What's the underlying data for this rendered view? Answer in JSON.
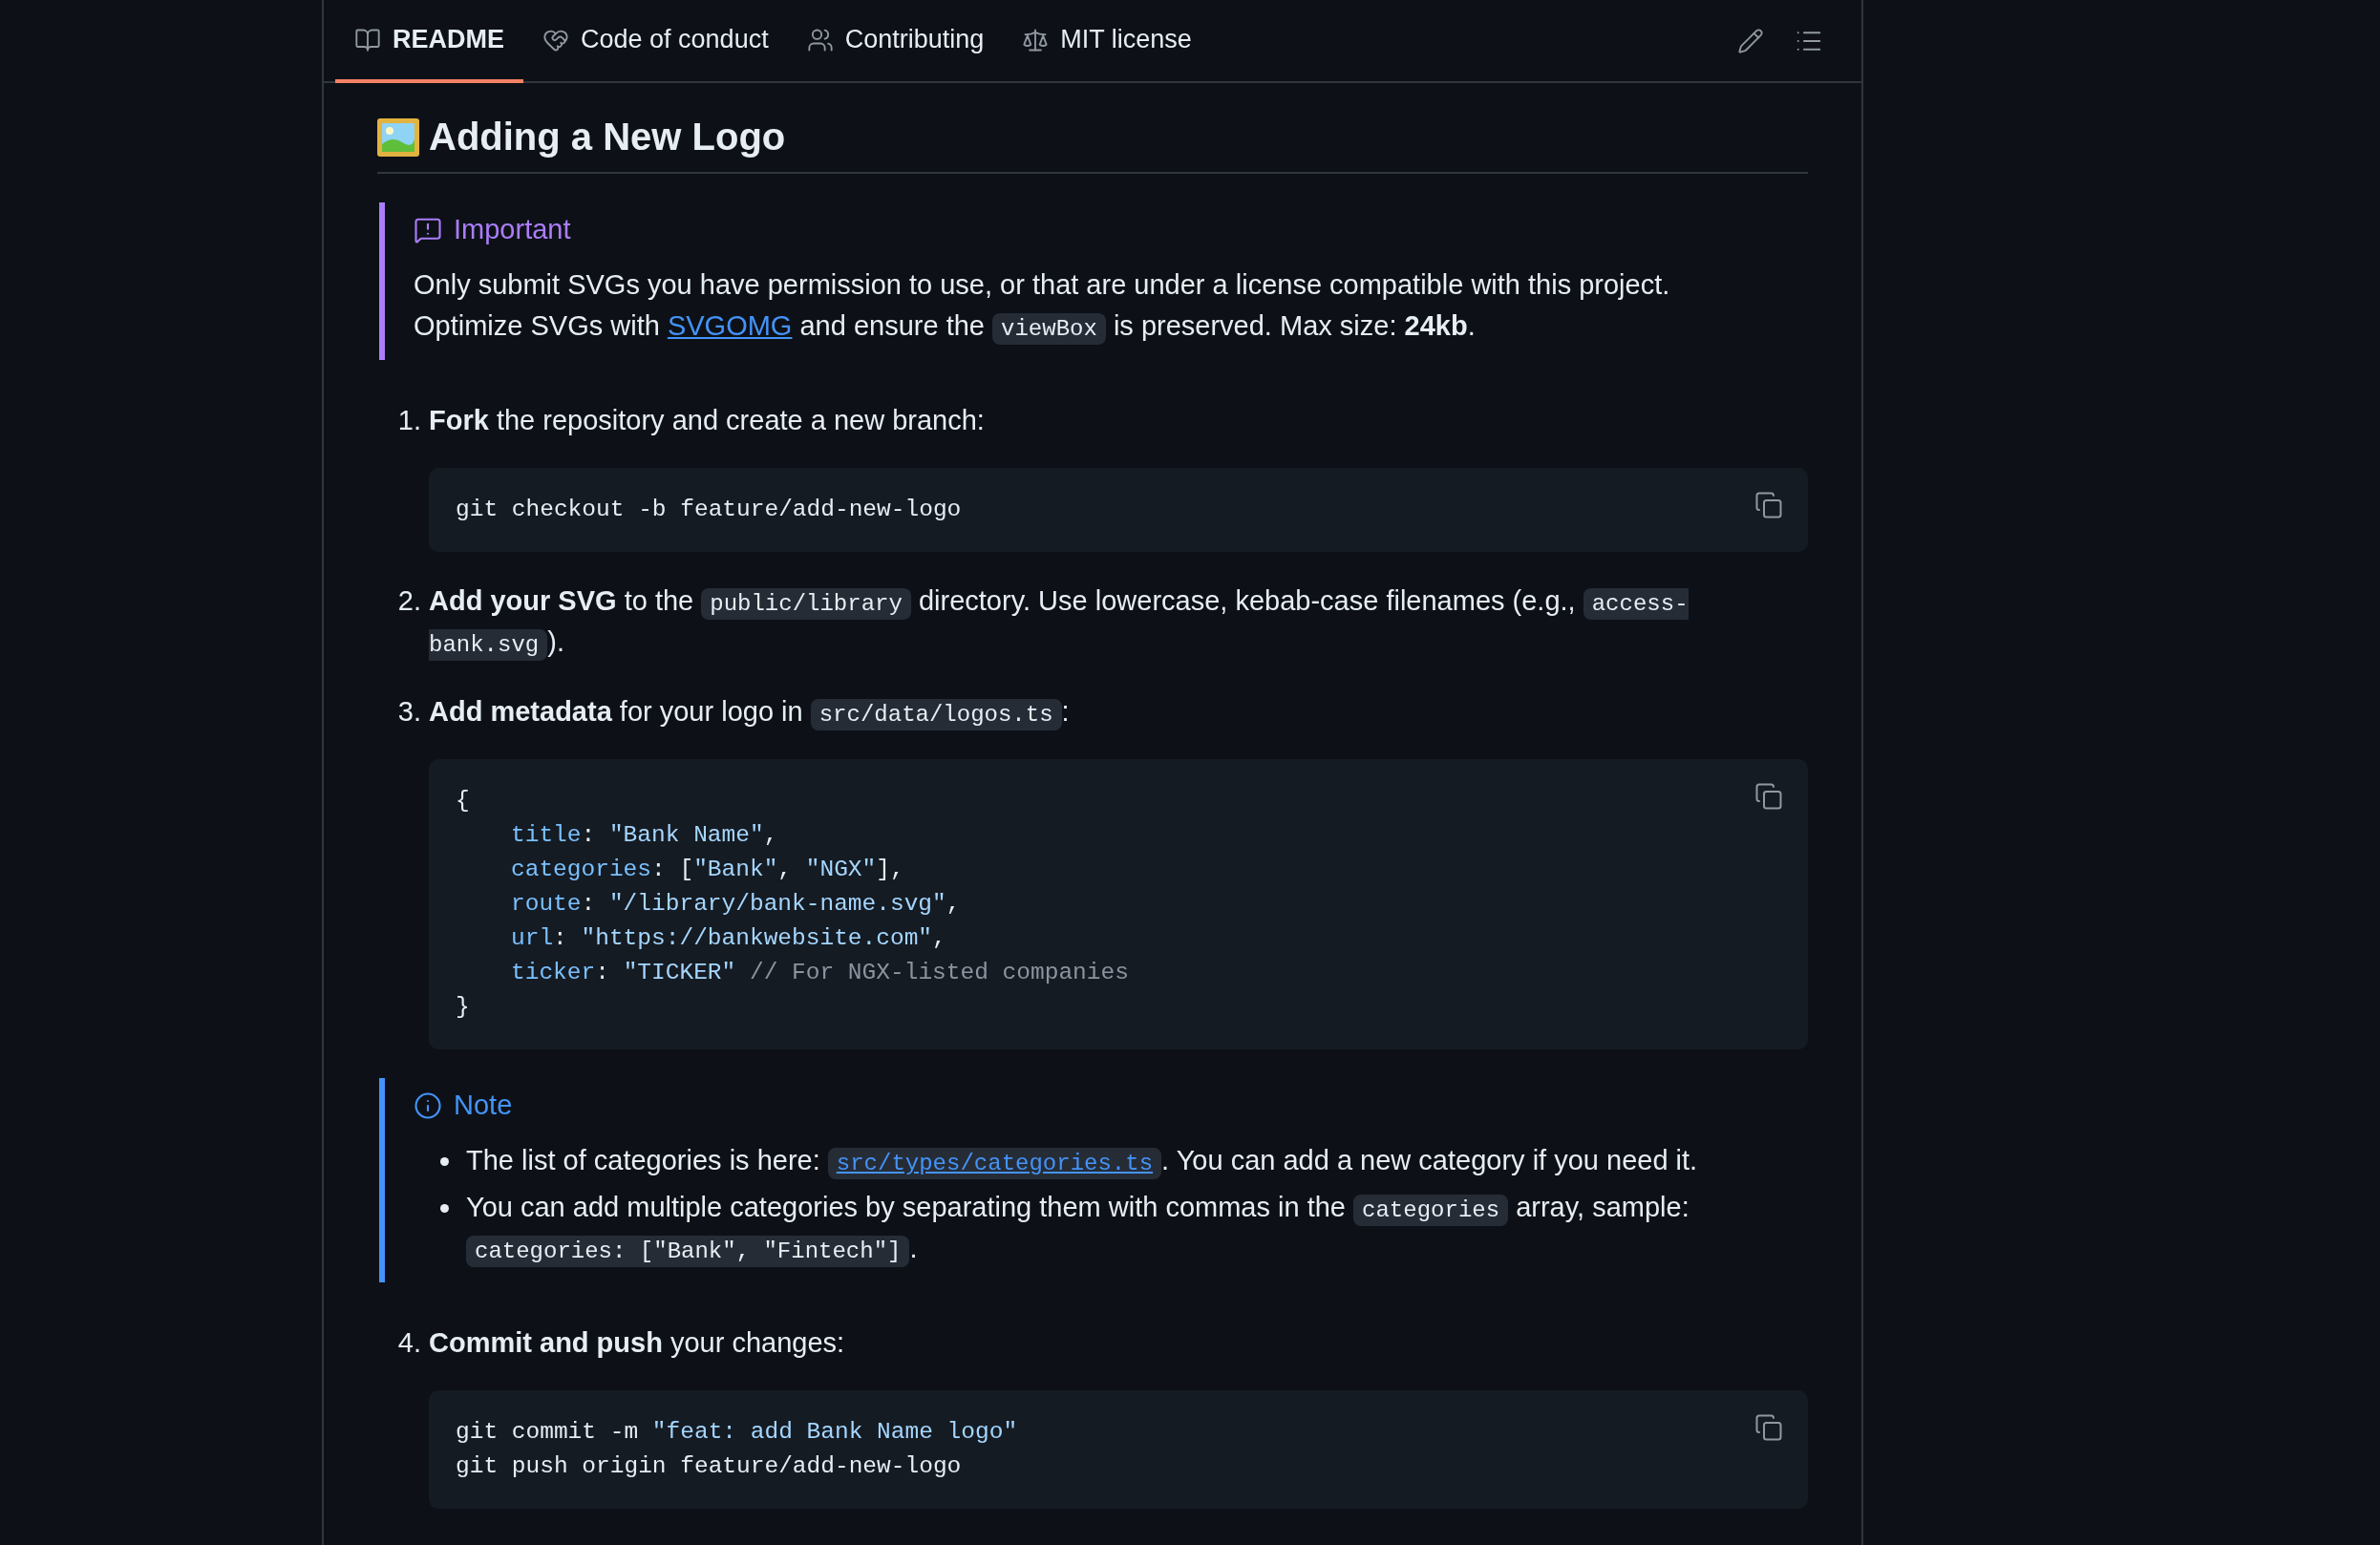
{
  "tabs": [
    {
      "label": "README",
      "selected": true
    },
    {
      "label": "Code of conduct",
      "selected": false
    },
    {
      "label": "Contributing",
      "selected": false
    },
    {
      "label": "MIT license",
      "selected": false
    }
  ],
  "heading": "Adding a New Logo",
  "blocks": [
    {
      "kind": "important",
      "title": "Important",
      "paragraphs": [
        [
          {
            "kind": "text",
            "text": "Only submit SVGs you have permission to use, or that are under a license compatible with this project. Optimize SVGs with "
          },
          {
            "kind": "link",
            "text": "SVGOMG"
          },
          {
            "kind": "text",
            "text": " and ensure the "
          },
          {
            "kind": "code",
            "text": "viewBox"
          },
          {
            "kind": "text",
            "text": " is preserved. Max size: "
          },
          {
            "kind": "bold",
            "text": "24kb"
          },
          {
            "kind": "text",
            "text": "."
          }
        ]
      ]
    },
    {
      "kind": "step",
      "number": "1.",
      "segments": [
        {
          "kind": "bold",
          "text": "Fork"
        },
        {
          "kind": "text",
          "text": " the repository and create a new branch:"
        }
      ],
      "code": [
        {
          "indented": false,
          "tokens": [
            {
              "kind": "plain",
              "text": "git checkout -b feature/add-new-logo"
            }
          ]
        }
      ]
    },
    {
      "kind": "step",
      "number": "2.",
      "segments": [
        {
          "kind": "bold",
          "text": "Add your SVG"
        },
        {
          "kind": "text",
          "text": " to the "
        },
        {
          "kind": "code",
          "text": "public/library"
        },
        {
          "kind": "text",
          "text": " directory. Use lowercase, kebab-case filenames (e.g., "
        },
        {
          "kind": "code",
          "text": "access-bank.svg"
        },
        {
          "kind": "text",
          "text": ")."
        }
      ]
    },
    {
      "kind": "step",
      "number": "3.",
      "segments": [
        {
          "kind": "bold",
          "text": "Add metadata"
        },
        {
          "kind": "text",
          "text": " for your logo in "
        },
        {
          "kind": "code",
          "text": "src/data/logos.ts"
        },
        {
          "kind": "text",
          "text": ":"
        }
      ],
      "code": [
        {
          "indented": false,
          "tokens": [
            {
              "kind": "plain",
              "text": "{"
            }
          ]
        },
        {
          "indented": true,
          "tokens": [
            {
              "kind": "key",
              "text": "title"
            },
            {
              "kind": "plain",
              "text": ": "
            },
            {
              "kind": "string",
              "text": "\"Bank Name\""
            },
            {
              "kind": "plain",
              "text": ","
            }
          ]
        },
        {
          "indented": true,
          "tokens": [
            {
              "kind": "key",
              "text": "categories"
            },
            {
              "kind": "plain",
              "text": ": ["
            },
            {
              "kind": "string",
              "text": "\"Bank\""
            },
            {
              "kind": "plain",
              "text": ", "
            },
            {
              "kind": "string",
              "text": "\"NGX\""
            },
            {
              "kind": "plain",
              "text": "],"
            }
          ]
        },
        {
          "indented": true,
          "tokens": [
            {
              "kind": "key",
              "text": "route"
            },
            {
              "kind": "plain",
              "text": ": "
            },
            {
              "kind": "string",
              "text": "\"/library/bank-name.svg\""
            },
            {
              "kind": "plain",
              "text": ","
            }
          ]
        },
        {
          "indented": true,
          "tokens": [
            {
              "kind": "key",
              "text": "url"
            },
            {
              "kind": "plain",
              "text": ": "
            },
            {
              "kind": "string",
              "text": "\"https://bankwebsite.com\""
            },
            {
              "kind": "plain",
              "text": ","
            }
          ]
        },
        {
          "indented": true,
          "tokens": [
            {
              "kind": "key",
              "text": "ticker"
            },
            {
              "kind": "plain",
              "text": ": "
            },
            {
              "kind": "string",
              "text": "\"TICKER\""
            },
            {
              "kind": "comment",
              "text": " // For NGX-listed companies"
            }
          ]
        },
        {
          "indented": false,
          "tokens": [
            {
              "kind": "plain",
              "text": "}"
            }
          ]
        }
      ]
    },
    {
      "kind": "note",
      "title": "Note",
      "items": [
        [
          {
            "kind": "text",
            "text": "The list of categories is here: "
          },
          {
            "kind": "code_link",
            "text": "src/types/categories.ts"
          },
          {
            "kind": "text",
            "text": ". You can add a new category if you need it."
          }
        ],
        [
          {
            "kind": "text",
            "text": "You can add multiple categories by separating them with commas in the "
          },
          {
            "kind": "code",
            "text": "categories"
          },
          {
            "kind": "text",
            "text": " array, sample: "
          },
          {
            "kind": "code",
            "text": "categories: [\"Bank\", \"Fintech\"]"
          },
          {
            "kind": "text",
            "text": "."
          }
        ]
      ]
    },
    {
      "kind": "step",
      "number": "4.",
      "segments": [
        {
          "kind": "bold",
          "text": "Commit and push"
        },
        {
          "kind": "text",
          "text": " your changes:"
        }
      ],
      "code": [
        {
          "indented": false,
          "tokens": [
            {
              "kind": "plain",
              "text": "git commit -m "
            },
            {
              "kind": "string",
              "text": "\"feat: add Bank Name logo\""
            }
          ]
        },
        {
          "indented": false,
          "tokens": [
            {
              "kind": "plain",
              "text": "git push origin feature/add-new-logo"
            }
          ]
        }
      ]
    }
  ]
}
